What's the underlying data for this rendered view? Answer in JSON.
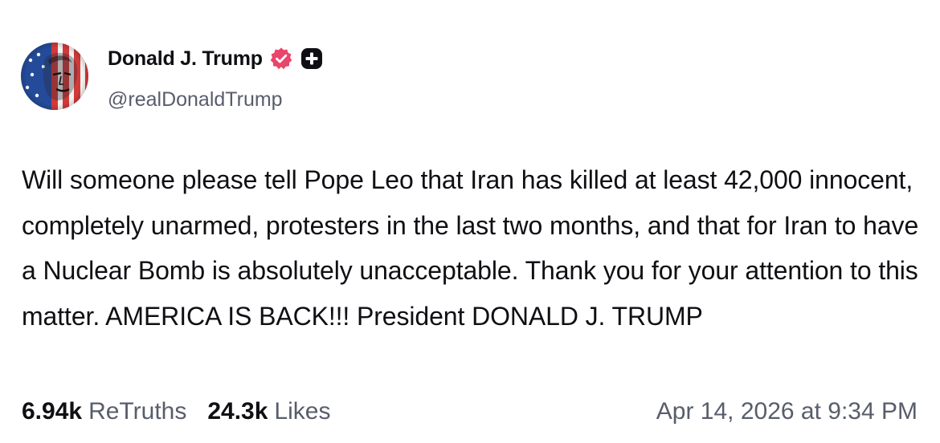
{
  "author": {
    "display_name": "Donald J. Trump",
    "handle": "@realDonaldTrump",
    "avatar_icon": "flag-portrait-avatar",
    "verified_icon": "verified-badge-icon",
    "verified_color": "#e9466b",
    "plus_icon": "plus-badge-icon"
  },
  "post": {
    "text": "Will someone please tell Pope Leo that Iran has killed at least 42,000 innocent, completely unarmed, protesters in the last two months, and that for Iran to have a Nuclear Bomb is absolutely unacceptable. Thank you for your attention to this matter. AMERICA IS BACK!!! President DONALD J. TRUMP"
  },
  "stats": {
    "retruths_count": "6.94k",
    "retruths_label": "ReTruths",
    "likes_count": "24.3k",
    "likes_label": "Likes"
  },
  "timestamp": "Apr 14, 2026 at 9:34 PM",
  "colors": {
    "text_primary": "#0f0f14",
    "text_secondary": "#585d6b",
    "background": "#ffffff"
  }
}
